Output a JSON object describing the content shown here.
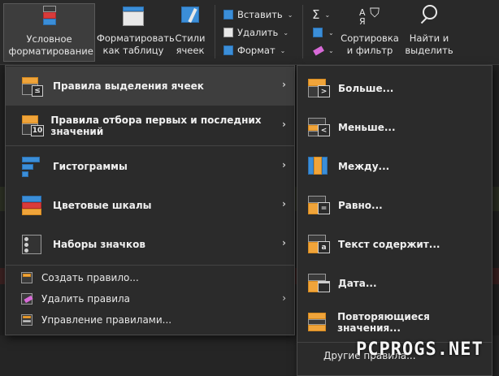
{
  "ribbon": {
    "conditional_formatting": "Условное форматирование",
    "format_as_table": "Форматировать как таблицу",
    "cell_styles": "Стили ячеек",
    "insert": "Вставить",
    "delete": "Удалить",
    "format": "Формат",
    "sort_filter": "Сортировка и фильтр",
    "find_select": "Найти и выделить",
    "chevron": "⌄",
    "sigma": "Σ"
  },
  "menu": {
    "items": [
      {
        "label": "Правила выделения ячеек"
      },
      {
        "label": "Правила отбора первых и последних значений"
      },
      {
        "label": "Гистограммы"
      },
      {
        "label": "Цветовые шкалы"
      },
      {
        "label": "Наборы значков"
      }
    ],
    "actions": [
      {
        "label": "Создать правило..."
      },
      {
        "label": "Удалить правила"
      },
      {
        "label": "Управление правилами..."
      }
    ],
    "arrow": "›"
  },
  "submenu": {
    "items": [
      {
        "label": "Больше...",
        "badge": ">"
      },
      {
        "label": "Меньше...",
        "badge": "<"
      },
      {
        "label": "Между..."
      },
      {
        "label": "Равно...",
        "badge": "="
      },
      {
        "label": "Текст содержит...",
        "badge": "a"
      },
      {
        "label": "Дата..."
      },
      {
        "label": "Повторяющиеся значения..."
      }
    ],
    "more": "Другие правила..."
  },
  "watermark": "PCPROGS.NET",
  "colors": {
    "accent_orange": "#f0a43a",
    "accent_blue": "#3b8ed8",
    "accent_red": "#d83b3b",
    "menu_bg": "#2b2b2b",
    "highlight_bg": "#3e3e3e"
  }
}
